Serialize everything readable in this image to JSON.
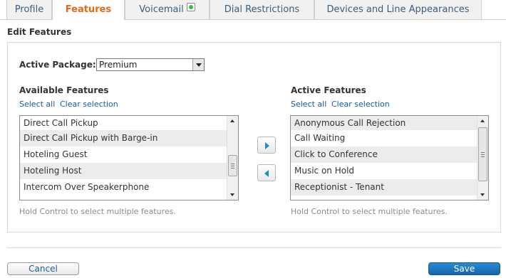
{
  "tabs": [
    {
      "label": "Profile"
    },
    {
      "label": "Features"
    },
    {
      "label": "Voicemail"
    },
    {
      "label": "Dial Restrictions"
    },
    {
      "label": "Devices and Line Appearances"
    }
  ],
  "active_tab": "Features",
  "section_title": "Edit Features",
  "package": {
    "label": "Active Package:",
    "value": "Premium"
  },
  "available": {
    "title": "Available Features",
    "select_all": "Select all",
    "clear_selection": "Clear selection",
    "items": [
      "Direct Call Pickup",
      "Direct Call Pickup with Barge-in",
      "Hoteling Guest",
      "Hoteling Host",
      "Intercom Over Speakerphone"
    ],
    "hint": "Hold Control to select multiple features."
  },
  "active": {
    "title": "Active Features",
    "select_all": "Select all",
    "clear_selection": "Clear selection",
    "items": [
      "Anonymous Call Rejection",
      "Call Waiting",
      "Click to Conference",
      "Music on Hold",
      "Receptionist - Tenant"
    ],
    "hint": "Hold Control to select multiple features."
  },
  "buttons": {
    "cancel": "Cancel",
    "save": "Save"
  },
  "colors": {
    "accent_tab": "#e4690f",
    "link": "#0f5d9f",
    "primary_button": "#1a77c2",
    "arrow": "#1e8fc6"
  }
}
